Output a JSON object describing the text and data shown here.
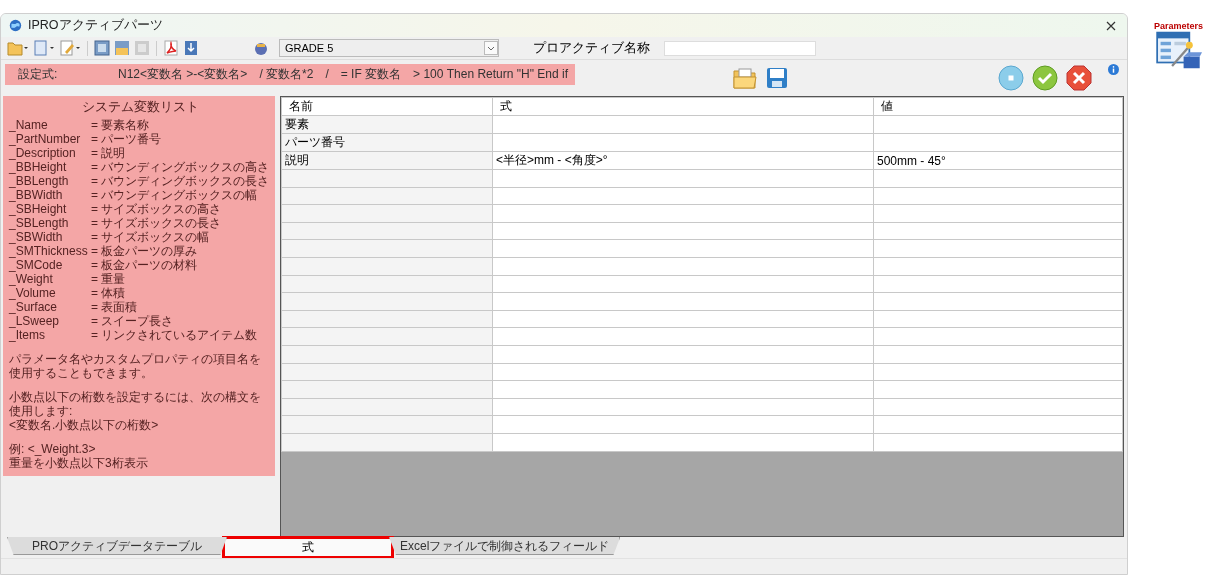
{
  "window": {
    "title": "IPROアクティブパーツ"
  },
  "toolbar": {
    "grade": "GRADE 5",
    "name_label": "プロアクティブ名称"
  },
  "formula_bar": {
    "label": "設定式:",
    "text": "N12<変数名 >-<変数名>　/ 変数名*2　/　= IF 変数名　> 100 Then Return \"H\" End if"
  },
  "variables": {
    "title": "システム変数リスト",
    "items": [
      {
        "name": "_Name",
        "desc": "= 要素名称"
      },
      {
        "name": "_PartNumber",
        "desc": "= パーツ番号"
      },
      {
        "name": "_Description",
        "desc": "= 説明"
      },
      {
        "name": "_BBHeight",
        "desc": "= バウンディングボックスの高さ"
      },
      {
        "name": "_BBLength",
        "desc": "= バウンディングボックスの長さ"
      },
      {
        "name": "_BBWidth",
        "desc": "= バウンディングボックスの幅"
      },
      {
        "name": "_SBHeight",
        "desc": "= サイズボックスの高さ"
      },
      {
        "name": "_SBLength",
        "desc": "= サイズボックスの長さ"
      },
      {
        "name": "_SBWidth",
        "desc": "= サイズボックスの幅"
      },
      {
        "name": "_SMThickness",
        "desc": "= 板金パーツの厚み"
      },
      {
        "name": "_SMCode",
        "desc": "= 板金パーツの材料"
      },
      {
        "name": "_Weight",
        "desc": "= 重量"
      },
      {
        "name": "_Volume",
        "desc": "= 体積"
      },
      {
        "name": "_Surface",
        "desc": "= 表面積"
      },
      {
        "name": "_LSweep",
        "desc": "= スイープ長さ"
      },
      {
        "name": "_Items",
        "desc": "= リンクされているアイテム数"
      }
    ],
    "notes": [
      "パラメータ名やカスタムプロパティの項目名を使用することもできます。",
      "小数点以下の桁数を設定するには、次の構文を使用します:",
      "<変数名.小数点以下の桁数>",
      "例: <_Weight.3>",
      "重量を小数点以下3桁表示"
    ]
  },
  "table": {
    "columns": [
      "名前",
      "式",
      "値"
    ],
    "rows": [
      {
        "name": "要素"
      },
      {
        "name": "パーツ番号"
      },
      {
        "name": "説明",
        "formula": "<半径>mm - <角度>°",
        "value": "500mm - 45°"
      }
    ]
  },
  "tabs": [
    {
      "label": "PROアクティブデータテーブル",
      "selected": false,
      "highlighted": false
    },
    {
      "label": "式",
      "selected": true,
      "highlighted": true
    },
    {
      "label": "Excelファイルで制御されるフィールド",
      "selected": false,
      "highlighted": false
    }
  ],
  "side_icon": {
    "label": "Parameters"
  }
}
